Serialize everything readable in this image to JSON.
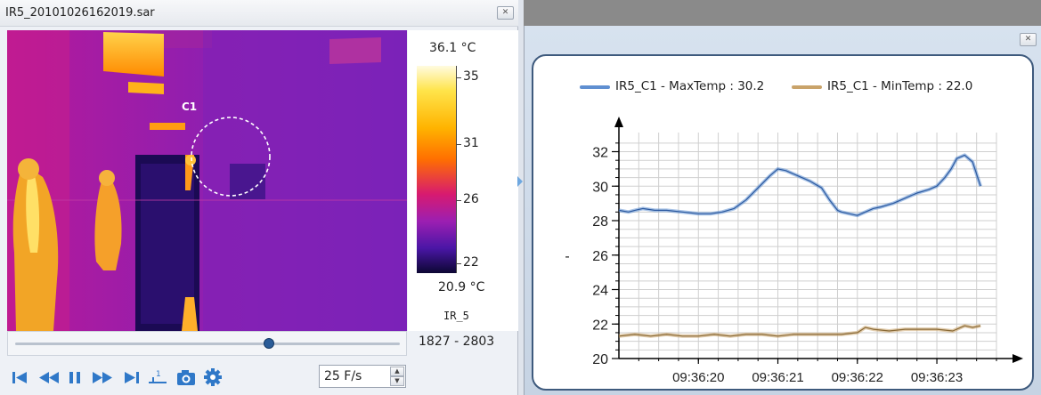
{
  "thermal_window": {
    "title": "IR5_20101026162019.sar",
    "roi_label": "C1",
    "colorbar": {
      "max_label": "36.1 °C",
      "min_label": "20.9 °C",
      "ticks": [
        "35",
        "31",
        "26",
        "22"
      ],
      "sensor_name": "IR_5"
    },
    "frame_range": "1827 - 2803",
    "slider_position": 0.66,
    "controls": [
      "skip-to-start-icon",
      "rewind-icon",
      "pause-icon",
      "fast-forward-icon",
      "skip-to-end-icon",
      "step-frame-icon",
      "snapshot-camera-icon",
      "settings-gear-icon"
    ],
    "fps_value": "25 F/s"
  },
  "chart_window": {
    "legend": [
      {
        "name": "IR5_C1 - MaxTemp : 30.2",
        "color": "#5f8fd1"
      },
      {
        "name": "IR5_C1 - MinTemp : 22.0",
        "color": "#c9a36a"
      }
    ]
  },
  "chart_data": {
    "type": "line",
    "ylabel": "-",
    "ylim": [
      20,
      32.8
    ],
    "yticks": [
      "20",
      "22",
      "24",
      "26",
      "28",
      "30",
      "32"
    ],
    "xticks": [
      "09:36:20",
      "09:36:21",
      "09:36:22",
      "09:36:23"
    ],
    "xtick_positions": [
      1.0,
      2.0,
      3.0,
      4.0
    ],
    "xlim": [
      0,
      4.75
    ],
    "grid": true,
    "series": [
      {
        "name": "IR5_C1 - MaxTemp : 30.2",
        "color": "#5f8fd1",
        "x": [
          0.0,
          0.12,
          0.2,
          0.3,
          0.45,
          0.6,
          0.8,
          1.0,
          1.15,
          1.3,
          1.45,
          1.6,
          1.75,
          1.9,
          2.0,
          2.1,
          2.25,
          2.4,
          2.55,
          2.65,
          2.75,
          2.8,
          2.9,
          3.0,
          3.1,
          3.2,
          3.3,
          3.45,
          3.6,
          3.75,
          3.9,
          4.0,
          4.1,
          4.18,
          4.25,
          4.35,
          4.45,
          4.55
        ],
        "y": [
          28.6,
          28.5,
          28.6,
          28.7,
          28.6,
          28.6,
          28.5,
          28.4,
          28.4,
          28.5,
          28.7,
          29.2,
          29.9,
          30.6,
          31.0,
          30.9,
          30.6,
          30.3,
          29.9,
          29.2,
          28.6,
          28.5,
          28.4,
          28.3,
          28.5,
          28.7,
          28.8,
          29.0,
          29.3,
          29.6,
          29.8,
          30.0,
          30.5,
          31.0,
          31.6,
          31.8,
          31.4,
          30.0
        ]
      },
      {
        "name": "IR5_C1 - MinTemp : 22.0",
        "color": "#c9a36a",
        "x": [
          0.0,
          0.2,
          0.4,
          0.6,
          0.8,
          1.0,
          1.2,
          1.4,
          1.6,
          1.8,
          2.0,
          2.2,
          2.4,
          2.6,
          2.8,
          3.0,
          3.1,
          3.2,
          3.4,
          3.6,
          3.8,
          4.0,
          4.2,
          4.35,
          4.45,
          4.55
        ],
        "y": [
          21.3,
          21.4,
          21.3,
          21.4,
          21.3,
          21.3,
          21.4,
          21.3,
          21.4,
          21.4,
          21.3,
          21.4,
          21.4,
          21.4,
          21.4,
          21.5,
          21.8,
          21.7,
          21.6,
          21.7,
          21.7,
          21.7,
          21.6,
          21.9,
          21.8,
          21.9
        ]
      }
    ]
  }
}
